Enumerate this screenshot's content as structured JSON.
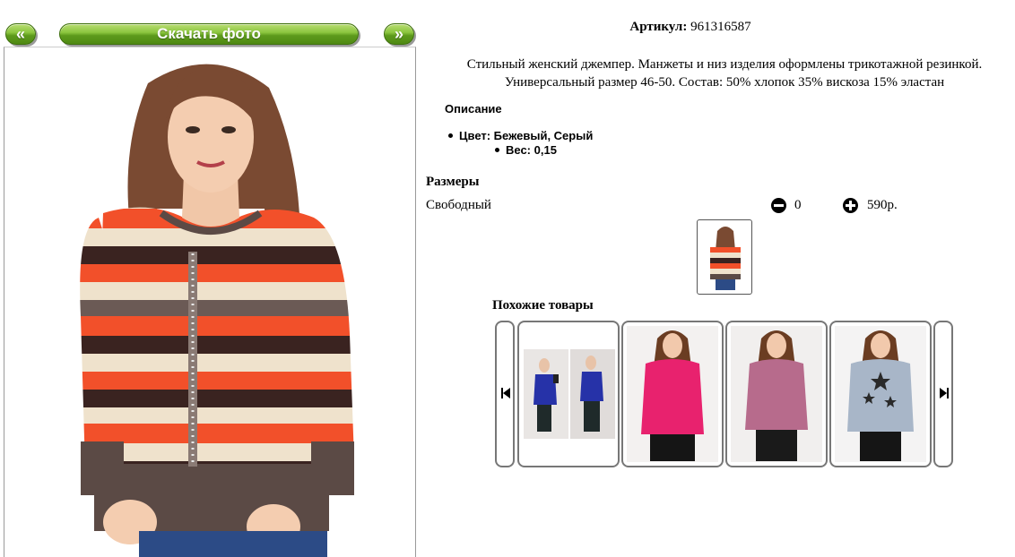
{
  "nav": {
    "prev_label": "«",
    "download_label": "Скачать фото",
    "next_label": "»"
  },
  "product": {
    "article_label": "Артикул:",
    "article_value": "961316587",
    "description_line1": "Стильный женский джемпер. Манжеты и низ изделия оформлены трикотажной резинкой.",
    "description_line2": "Универсальный размер 46-50. Состав: 50% хлопок 35% вискоза 15% эластан",
    "section_title": "Описание",
    "spec_color": "Цвет: Бежевый, Серый",
    "spec_weight": "Вес: 0,15"
  },
  "sizes": {
    "title": "Размеры",
    "rows": [
      {
        "name": "Свободный",
        "quantity": "0",
        "price": "590р."
      }
    ]
  },
  "similar": {
    "title": "Похожие товары",
    "items": [
      {
        "icon": "two-photos-blue-sweater",
        "colors": [
          "#2632a8",
          "#1f2a2a"
        ]
      },
      {
        "icon": "pink-sweater",
        "colors": [
          "#e8226e"
        ]
      },
      {
        "icon": "mauve-sweater",
        "colors": [
          "#b76b8c"
        ]
      },
      {
        "icon": "grey-star-sweater",
        "colors": [
          "#a8b6c8"
        ]
      }
    ]
  },
  "colors": {
    "button_green": "#6aae22",
    "stripe_coral": "#f2502a",
    "stripe_brown": "#3a2320",
    "stripe_beige": "#efe2cc"
  }
}
